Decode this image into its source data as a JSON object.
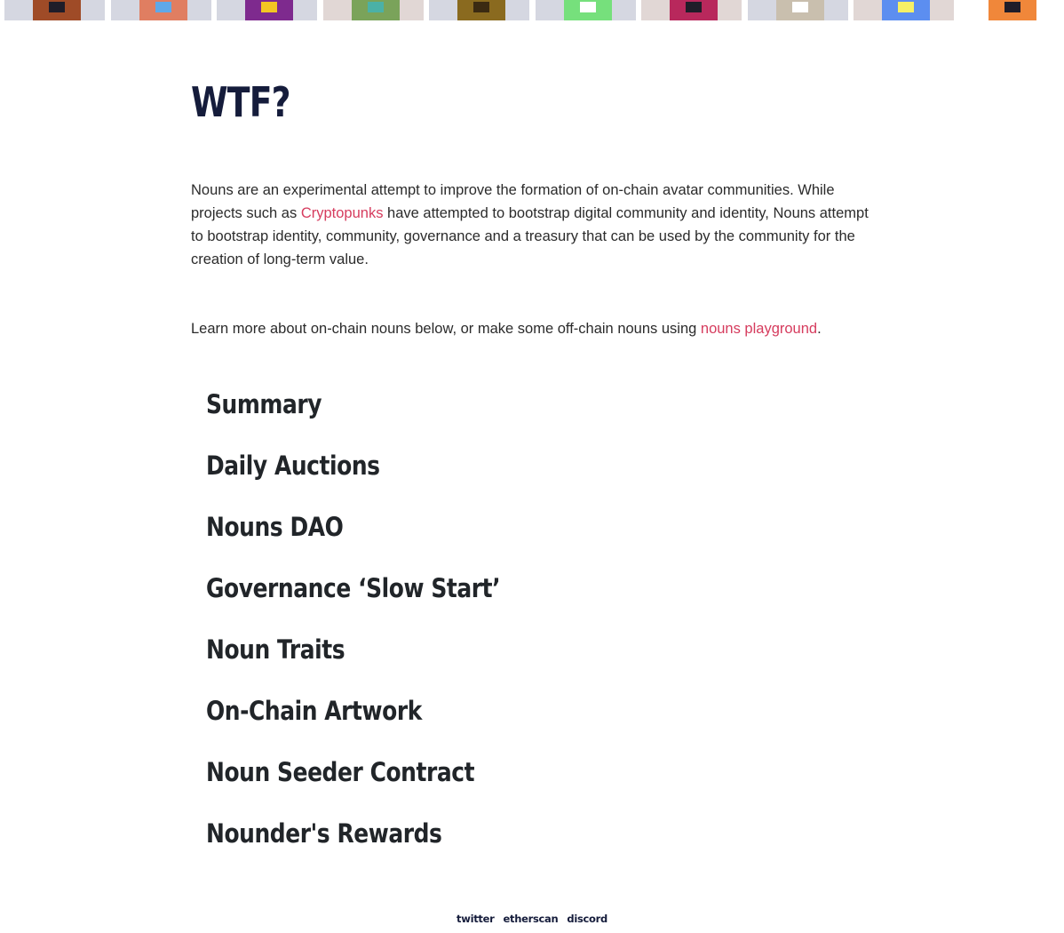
{
  "noun_strip": [
    {
      "bg": "#d5d7e1",
      "body": "#9f4b27",
      "head": "#1f1d29",
      "name": "noun-thumbnail"
    },
    {
      "bg": "#d5d7e1",
      "body": "#e07e61",
      "head": "#5fa8e8",
      "name": "noun-thumbnail"
    },
    {
      "bg": "#d5d7e1",
      "body": "#7e2a8e",
      "head": "#f3c623",
      "name": "noun-thumbnail"
    },
    {
      "bg": "#e1d7d5",
      "body": "#7aa35a",
      "head": "#4bb1a6",
      "name": "noun-thumbnail"
    },
    {
      "bg": "#d5d7e1",
      "body": "#8a6a1f",
      "head": "#3b2a12",
      "name": "noun-thumbnail"
    },
    {
      "bg": "#d5d7e1",
      "body": "#76e07c",
      "head": "#ffffff",
      "name": "noun-thumbnail"
    },
    {
      "bg": "#e1d7d5",
      "body": "#b8285c",
      "head": "#1f1d29",
      "name": "noun-thumbnail"
    },
    {
      "bg": "#d5d7e1",
      "body": "#c9bfae",
      "head": "#ffffff",
      "name": "noun-thumbnail"
    },
    {
      "bg": "#e1d7d5",
      "body": "#5c8ef0",
      "head": "#f5f066",
      "name": "noun-thumbnail"
    },
    {
      "bg": "#ffffff",
      "body": "#f0873a",
      "head": "#1f1d29",
      "name": "noun-thumbnail"
    }
  ],
  "page": {
    "title": "WTF?",
    "intro_before": "Nouns are an experimental attempt to improve the formation of on-chain avatar communities. While projects such as ",
    "intro_link": "Cryptopunks",
    "intro_after": " have attempted to bootstrap digital community and identity, Nouns attempt to bootstrap identity, community, governance and a treasury that can be used by the community for the creation of long-term value.",
    "learn_before": "Learn more about on-chain nouns below, or make some off-chain nouns using ",
    "learn_link": "nouns playground",
    "learn_after": "."
  },
  "accordion": [
    "Summary",
    "Daily Auctions",
    "Nouns DAO",
    "Governance ‘Slow Start’",
    "Noun Traits",
    "On-Chain Artwork",
    "Noun Seeder Contract",
    "Nounder's Rewards"
  ],
  "footer": {
    "twitter": "twitter",
    "etherscan": "etherscan",
    "discord": "discord"
  },
  "colors": {
    "link": "#d63c5e",
    "title": "#151c3b",
    "text": "#2b2b2b"
  }
}
